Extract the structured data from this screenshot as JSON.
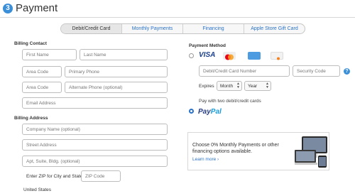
{
  "header": {
    "step": "3",
    "title": "Payment"
  },
  "tabs": [
    {
      "label": "Debit/Credit Card"
    },
    {
      "label": "Monthly Payments"
    },
    {
      "label": "Financing"
    },
    {
      "label": "Apple Store Gift Card"
    }
  ],
  "billing_contact": {
    "heading": "Billing Contact",
    "first_name": "First Name",
    "last_name": "Last Name",
    "area_code": "Area Code",
    "primary_phone": "Primary Phone",
    "alt_area_code": "Area Code",
    "alt_phone": "Alternate Phone (optional)",
    "email": "Email Address"
  },
  "billing_address": {
    "heading": "Billing Address",
    "company": "Company Name (optional)",
    "street": "Street Address",
    "apt": "Apt, Suite, Bldg. (optional)",
    "zip_label": "Enter ZIP for City and State",
    "zip": "ZIP Code",
    "country": "United States"
  },
  "payment_method": {
    "heading": "Payment Method",
    "visa": "VISA",
    "card_number": "Debit/Credit Card Number",
    "security_code": "Security Code",
    "help": "?",
    "expires_label": "Expires",
    "month": "Month",
    "year": "Year",
    "two_cards": "Pay with two debit/credit cards",
    "paypal_pay": "Pay",
    "paypal_pal": "Pal"
  },
  "promo": {
    "text": "Choose 0% Monthly Payments or other financing options available.",
    "link": "Learn more ›"
  },
  "colors": {
    "accent": "#2a72c8",
    "paypal_dark": "#253b80",
    "paypal_light": "#179bd7"
  }
}
